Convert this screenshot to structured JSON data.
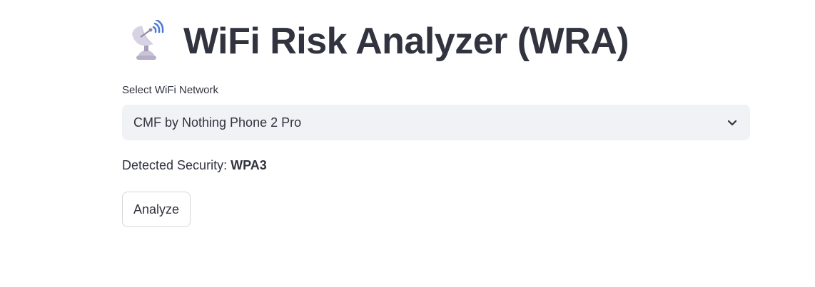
{
  "header": {
    "icon": "satellite-antenna-icon",
    "title": "WiFi Risk Analyzer (WRA)"
  },
  "network_select": {
    "label": "Select WiFi Network",
    "selected_value": "CMF by Nothing Phone 2 Pro",
    "icon": "chevron-down-icon"
  },
  "security": {
    "label": "Detected Security:",
    "value": "WPA3"
  },
  "actions": {
    "analyze_label": "Analyze"
  }
}
